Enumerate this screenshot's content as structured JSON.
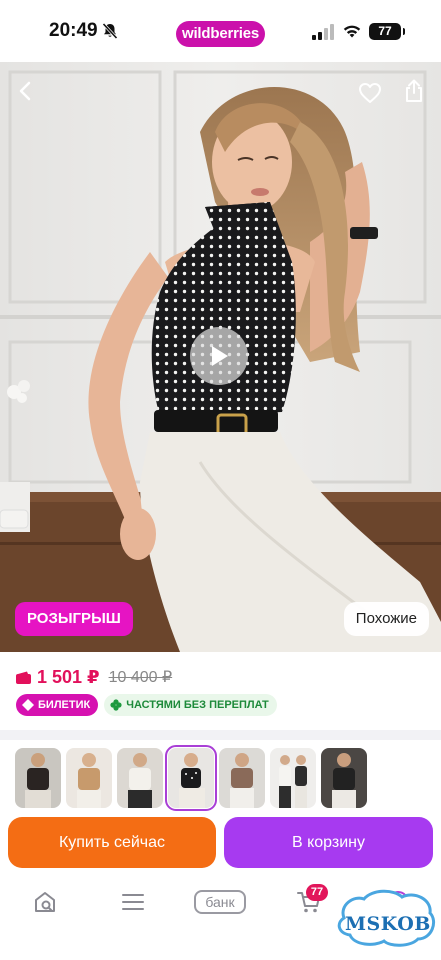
{
  "status_bar": {
    "time": "20:49",
    "brand": "wildberries",
    "battery": "77",
    "icons": [
      "bell-muted-icon",
      "signal-icon",
      "wifi-icon",
      "battery-icon"
    ]
  },
  "hero": {
    "icons": [
      "back-chevron-icon",
      "heart-icon",
      "share-icon",
      "play-icon"
    ],
    "raffle_label": "РОЗЫГРЫШ",
    "similar_label": "Похожие"
  },
  "price": {
    "current": "1 501 ₽",
    "old": "10 400 ₽",
    "icon": "wallet-icon"
  },
  "badges": {
    "ticket": "БИЛЕТИК",
    "installments": "ЧАСТЯМИ БЕЗ ПЕРЕПЛАТ"
  },
  "thumbnails": {
    "count": 7,
    "active_index": 3
  },
  "actions": {
    "buy_now": "Купить сейчас",
    "add_to_cart": "В корзину"
  },
  "bottom_nav": {
    "bank": "банк",
    "cart_count": "77",
    "icons": [
      "home-search-icon",
      "catalog-icon",
      "bank-icon",
      "cart-icon",
      "profile-icon"
    ]
  },
  "watermark": {
    "text": "MSKOB"
  },
  "colors": {
    "brand": "#cb11ab",
    "price": "#e2105b",
    "buy_now": "#f46d14",
    "cart": "#a73af0"
  }
}
